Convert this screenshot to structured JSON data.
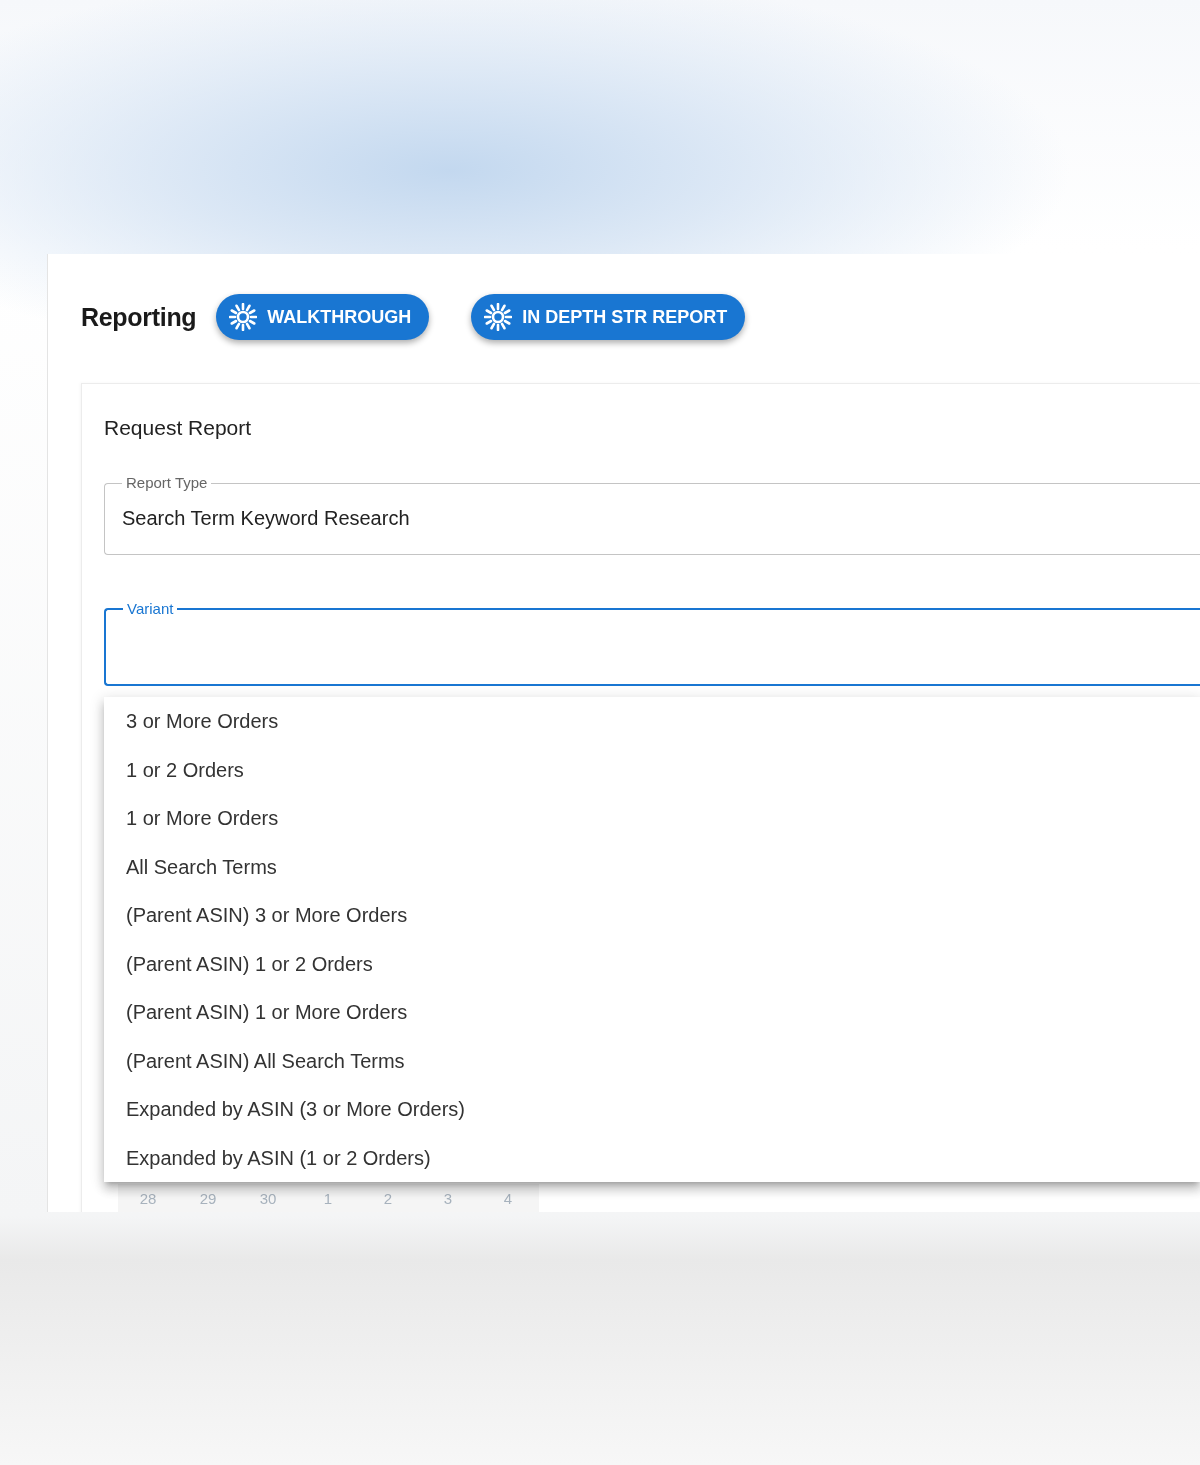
{
  "header": {
    "title": "Reporting",
    "buttons": [
      {
        "label": "WALKTHROUGH"
      },
      {
        "label": "IN DEPTH STR REPORT"
      }
    ]
  },
  "request_card": {
    "title": "Request Report",
    "fields": [
      {
        "label": "Report Type",
        "value": "Search Term Keyword Research",
        "focused": false
      },
      {
        "label": "Variant",
        "focused": true
      }
    ]
  },
  "variant_menu": {
    "options": [
      {
        "label": "3 or More Orders",
        "selected": false
      },
      {
        "label": "1 or 2 Orders",
        "selected": false
      },
      {
        "label": "1 or More Orders",
        "selected": false
      },
      {
        "label": "All Search Terms",
        "selected": false
      },
      {
        "label": "(Parent ASIN) 3 or More Orders",
        "selected": false
      },
      {
        "label": "(Parent ASIN) 1 or 2 Orders",
        "selected": false
      },
      {
        "label": "(Parent ASIN) 1 or More Orders",
        "selected": false
      },
      {
        "label": "(Parent ASIN) All Search Terms",
        "selected": false
      },
      {
        "label": "Expanded by ASIN (3 or More Orders)",
        "selected": false
      },
      {
        "label": "Expanded by ASIN (1 or 2 Orders)",
        "selected": false
      }
    ]
  },
  "calendar_row": {
    "days": [
      "28",
      "29",
      "30",
      "1",
      "2",
      "3",
      "4"
    ]
  }
}
